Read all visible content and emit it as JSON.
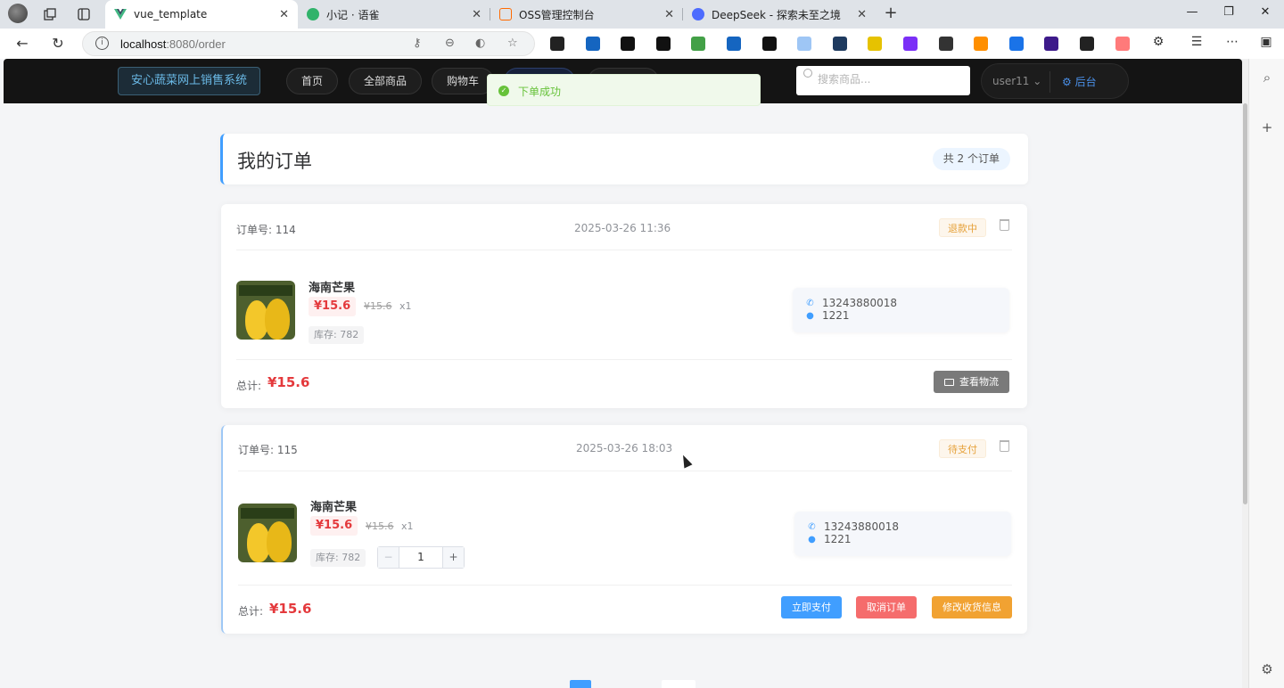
{
  "browser": {
    "tabs": [
      {
        "title": "vue_template",
        "favicon_color": "#41b883",
        "active": true
      },
      {
        "title": "小记 · 语雀",
        "favicon_color": "#31b36b",
        "active": false
      },
      {
        "title": "OSS管理控制台",
        "favicon_color": "#ff6a00",
        "active": false
      },
      {
        "title": "DeepSeek - 探索未至之境",
        "favicon_color": "#4d6bfe",
        "active": false
      }
    ],
    "url_host": "localhost",
    "url_rest": ":8080/order",
    "extension_colors": [
      "#222222",
      "#1565c0",
      "#111111",
      "#111111",
      "#43a047",
      "#1565c0",
      "#111111",
      "#9ec6f5",
      "#1e3a5f",
      "#e6c200",
      "#7b2ff7",
      "#333333",
      "#ff8f00",
      "#1a73e8",
      "#3d1a8a",
      "#222222",
      "#ff7a7a"
    ]
  },
  "header": {
    "brand": "安心蔬菜网上销售系统",
    "nav": [
      "首页",
      "全部商品",
      "购物车"
    ],
    "search_placeholder": "搜索商品...",
    "username": "user11",
    "admin_label": "后台"
  },
  "toast": {
    "message": "下单成功"
  },
  "page": {
    "title": "我的订单",
    "count_label": "共 2 个订单"
  },
  "orders": [
    {
      "no_label": "订单号: 114",
      "time": "2025-03-26 11:36",
      "status": "退款中",
      "product": {
        "name": "海南芒果",
        "price": "¥15.6",
        "original_price": "¥15.6",
        "qty": "x1",
        "stock": "库存: 782"
      },
      "phone": "13243880018",
      "address": "1221",
      "total_label": "总计:",
      "total": "¥15.6",
      "actions": [
        "查看物流"
      ]
    },
    {
      "no_label": "订单号: 115",
      "time": "2025-03-26 18:03",
      "status": "待支付",
      "product": {
        "name": "海南芒果",
        "price": "¥15.6",
        "original_price": "¥15.6",
        "qty": "x1",
        "stock": "库存: 782",
        "stepper_value": "1"
      },
      "phone": "13243880018",
      "address": "1221",
      "total_label": "总计:",
      "total": "¥15.6",
      "actions": [
        "立即支付",
        "取消订单",
        "修改收货信息"
      ]
    }
  ]
}
